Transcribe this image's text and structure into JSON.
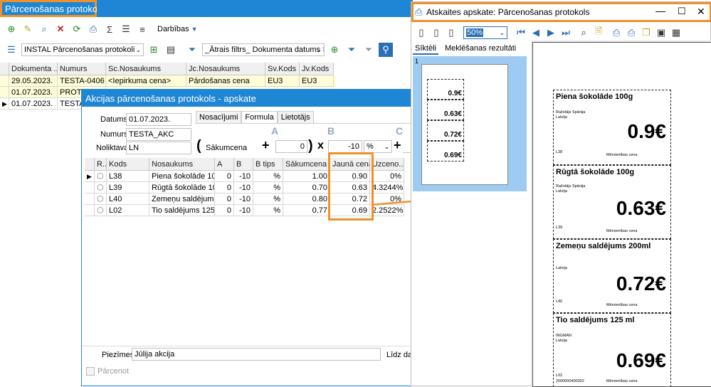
{
  "main": {
    "title": "Pārcenošanas protokoli",
    "menu_label": "Darbības",
    "dropdown_value": "INSTAL Pārcenošanas protokoli",
    "filter_value": "_Ātrais filtrs_ Dokumenta datums >=",
    "columns": [
      "Dokumenta ...",
      "Numurs",
      "Sc.Nosaukums",
      "Jc.Nosaukums",
      "Sv.Kods",
      "Jv.Kods"
    ],
    "rows": [
      [
        "29.05.2023.",
        "TESTA-0406",
        "<Iepirkuma cena>",
        "Pārdošanas cena",
        "EU3",
        "EU3"
      ],
      [
        "01.07.2023.",
        "PROT-0",
        "",
        "",
        "",
        ""
      ],
      [
        "01.07.2023.",
        "TESTA",
        "",
        "",
        "",
        ""
      ]
    ]
  },
  "dialog": {
    "title": "Akcijas pārcenošanas protokols - apskate",
    "datums_label": "Datums:",
    "datums_value": "01.07.2023.",
    "numurs_label": "Numurs:",
    "numurs_value": "TESTA_AKC",
    "noliktava_label": "Noliktava:",
    "noliktava_value": "LN",
    "tabs": [
      "Nosacījumi",
      "Formula",
      "Lietotājs"
    ],
    "formula": {
      "a": "A",
      "b": "B",
      "c": "C",
      "sakumcena": "Sākumcena",
      "open": "(",
      "close": ")",
      "plus": "+",
      "times": "x",
      "plus2": "+",
      "zero": "0",
      "ten": "-10",
      "pct": "%"
    },
    "columns": [
      "R...",
      "Kods",
      "Nosaukums",
      "A",
      "B",
      "B tips",
      "Sākumcena",
      "Jaunā cena",
      "Uzceno..."
    ],
    "rows": [
      [
        "",
        "L38",
        "Piena šokolāde 100g",
        "0",
        "-10",
        "%",
        "1.00",
        "0.90",
        "0%"
      ],
      [
        "",
        "L39",
        "Rūgtā šokolāde 100g",
        "0",
        "-10",
        "%",
        "0.70",
        "0.63",
        "4.3244%"
      ],
      [
        "",
        "L40",
        "Zemeņu saldējums...",
        "0",
        "-10",
        "%",
        "0.80",
        "0.72",
        "0%"
      ],
      [
        "",
        "L02",
        "Tio saldējums 125 ml",
        "0",
        "-10",
        "%",
        "0.77",
        "0.69",
        "2.2522%"
      ]
    ],
    "piezimes_label": "Piezīmes:",
    "piezimes_value": "Jūlija akcija",
    "lidz_label": "Līdz dat",
    "parcenot_label": "Pārcenot"
  },
  "report": {
    "title": "Atskaites apskate: Pārcenošanas protokols",
    "zoom": "50%",
    "tabs": [
      "Sīktēli",
      "Meklēšanas rezultāti"
    ],
    "page_number": "1",
    "thumb_prices": [
      "0.9€",
      "0.63€",
      "0.72€",
      "0.69€"
    ],
    "labels": [
      {
        "name": "Piena šokolāde 100g",
        "maker": "Ražotājs Spānija",
        "country": "Latvija",
        "code": "L38",
        "unit": "Mērvienības cena",
        "price": "0.9€"
      },
      {
        "name": "Rūgtā šokolāde 100g",
        "maker": "Ražotājs Spānija",
        "country": "Latvija",
        "code": "L39",
        "unit": "Mērvienības cena",
        "price": "0.63€"
      },
      {
        "name": "Zemeņu saldējums 200ml",
        "maker": "",
        "country": "Latvija",
        "code": "L40",
        "unit": "Mērvienības cena",
        "price": "0.72€"
      },
      {
        "name": "Tio saldējums 125 ml",
        "maker": "INGMAN",
        "country": "Latvija",
        "code": "L02",
        "barcode": "2000000400002",
        "unit": "Mērvienības cena",
        "price": "0.69€"
      }
    ]
  }
}
